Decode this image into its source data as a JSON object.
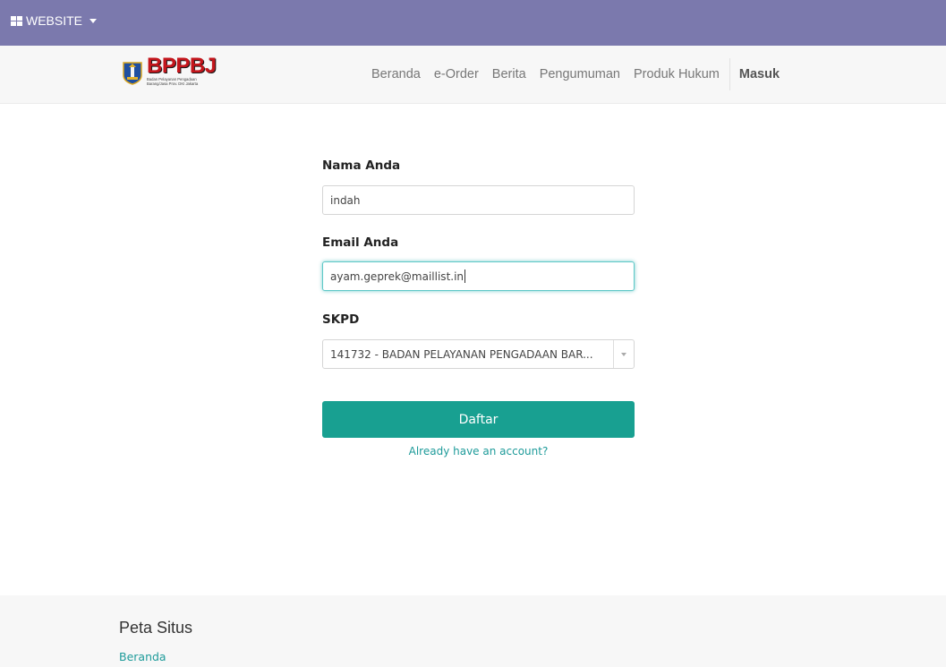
{
  "topbar": {
    "menu_label": "WEBSITE"
  },
  "brand": {
    "name": "BPPBJ",
    "subtitle_line1": "Badan Pelayanan Pengadaan",
    "subtitle_line2": "Barang/Jasa Prov. DKI Jakarta"
  },
  "nav": {
    "items": [
      "Beranda",
      "e-Order",
      "Berita",
      "Pengumuman",
      "Produk Hukum"
    ],
    "login": "Masuk"
  },
  "form": {
    "name_label": "Nama Anda",
    "name_value": "indah",
    "email_label": "Email Anda",
    "email_value": "ayam.geprek@maillist.in",
    "skpd_label": "SKPD",
    "skpd_value": "141732 - BADAN PELAYANAN PENGADAAN BAR...",
    "submit_label": "Daftar",
    "login_link": "Already have an account?"
  },
  "footer": {
    "heading": "Peta Situs",
    "links": [
      "Beranda"
    ]
  },
  "colors": {
    "topbar": "#7b79ad",
    "primary_button": "#18a091",
    "link": "#1e9b9a",
    "brand_red": "#c4161c"
  },
  "icons": {
    "menu": "grid-icon",
    "dropdown": "caret-down-icon",
    "select": "triangle-down-icon"
  }
}
